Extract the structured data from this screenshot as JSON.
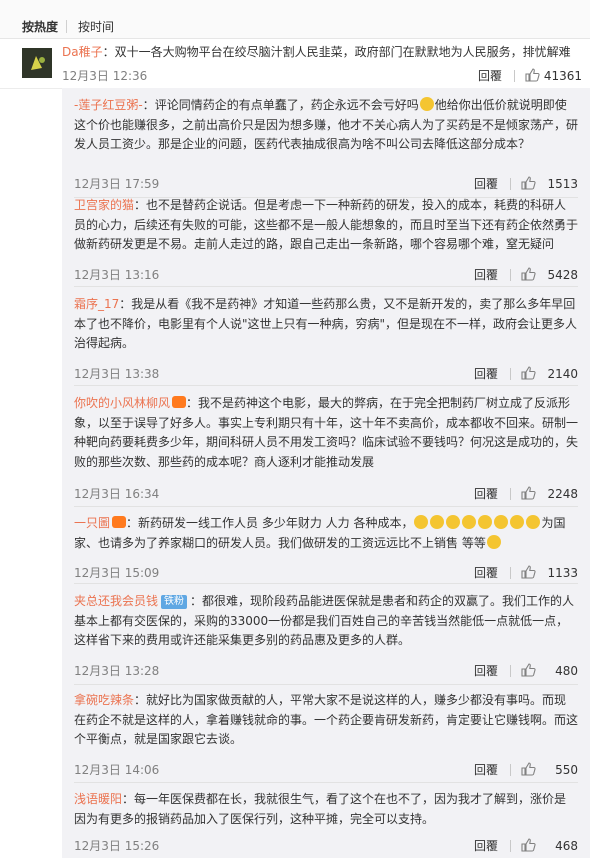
{
  "sort_tabs": {
    "hot": "按热度",
    "time": "按时间"
  },
  "top_comment": {
    "user": "Da稚子",
    "text": "双十一各大购物平台在绞尽脑汁割人民韭菜，政府部门在默默地为人民服务，排忧解难",
    "time": "12月3日 12:36",
    "reply_label": "回覆",
    "likes": "41361"
  },
  "replies": [
    {
      "user": "-莲子红豆粥-",
      "text_before": "评论同情药企的有点单蠢了，药企永远不会亏好吗",
      "text_after": "他给你出低价就说明即使这个价也能赚很多，之前出高价只是因为想多赚，他才不关心病人为了买药是不是倾家荡产，研发人员工资少。那是企业的问题，医药代表抽成很高为啥不叫公司去降低这部分成本？",
      "time": "12月3日 17:59",
      "reply_label": "回覆",
      "likes": "1513"
    },
    {
      "user": "卫宫家的猫",
      "text": "也不是替药企说话。但是考虑一下一种新药的研发，投入的成本，耗费的科研人员的心力，后续还有失败的可能，这些都不是一般人能想象的，而且时至当下还有药企依然勇于做新药研发更是不易。走前人走过的路，跟自己走出一条新路，哪个容易哪个难，窒无疑问",
      "time": "12月3日 13:16",
      "reply_label": "回覆",
      "likes": "5428"
    },
    {
      "user": "霜序_17",
      "text": "我是从看《我不是药神》才知道一些药那么贵，又不是新开发的，卖了那么多年早回本了也不降价，电影里有个人说\"这世上只有一种病，穷病\"，但是现在不一样，政府会让更多人治得起病。",
      "time": "12月3日 13:38",
      "reply_label": "回覆",
      "likes": "2140"
    },
    {
      "user": "你吹的小风林柳风",
      "text": "我不是药神这个电影，最大的弊病，在于完全把制药厂树立成了反派形象，以至于误导了好多人。事实上专利期只有十年，这十年不卖高价，成本都收不回来。研制一种靶向药要耗费多少年，期间科研人员不用发工资吗？临床试验不要钱吗？何况这是成功的，失败的那些次数、那些药的成本呢？商人逐利才能推动发展",
      "time": "12月3日 16:34",
      "reply_label": "回覆",
      "likes": "2248"
    },
    {
      "user": "一只圖",
      "text_before": "新药研发一线工作人员 多少年财力 人力 各种成本，",
      "text_after": "为国家、也请多为了养家糊口的研发人员。我们做研发的工资远远比不上销售 等等",
      "time": "12月3日 15:09",
      "reply_label": "回覆",
      "likes": "1133"
    },
    {
      "user": "夹总还我会员钱",
      "badge": "铁粉",
      "text": "都很难，现阶段药品能进医保就是患者和药企的双赢了。我们工作的人基本上都有交医保的，采购的33000一份都是我们百姓自己的辛苦钱当然能低一点就低一点，这样省下来的费用或许还能采集更多别的药品惠及更多的人群。",
      "time": "12月3日 13:28",
      "reply_label": "回覆",
      "likes": "480"
    },
    {
      "user": "拿碗吃辣条",
      "text": "就好比为国家做贡献的人，平常大家不是说这样的人，赚多少都没有事吗。而现在药企不就是这样的人，拿着赚钱就命的事。一个药企要肯研发新药，肯定要让它赚钱啊。而这个平衡点，就是国家跟它去谈。",
      "time": "12月3日 14:06",
      "reply_label": "回覆",
      "likes": "550"
    },
    {
      "user": "浅语暖阳",
      "text": "每一年医保费都在长，我就很生气，看了这个在也不了，因为我才了解到，涨价是因为有更多的报销药品加入了医保行列，这种平摊，完全可以支持。",
      "time": "12月3日 15:26",
      "reply_label": "回覆",
      "likes": "468"
    }
  ],
  "icon_names": [
    "thumbs-up-icon",
    "emoji-icon",
    "crying-emoji-icon",
    "fan-badge-icon"
  ]
}
